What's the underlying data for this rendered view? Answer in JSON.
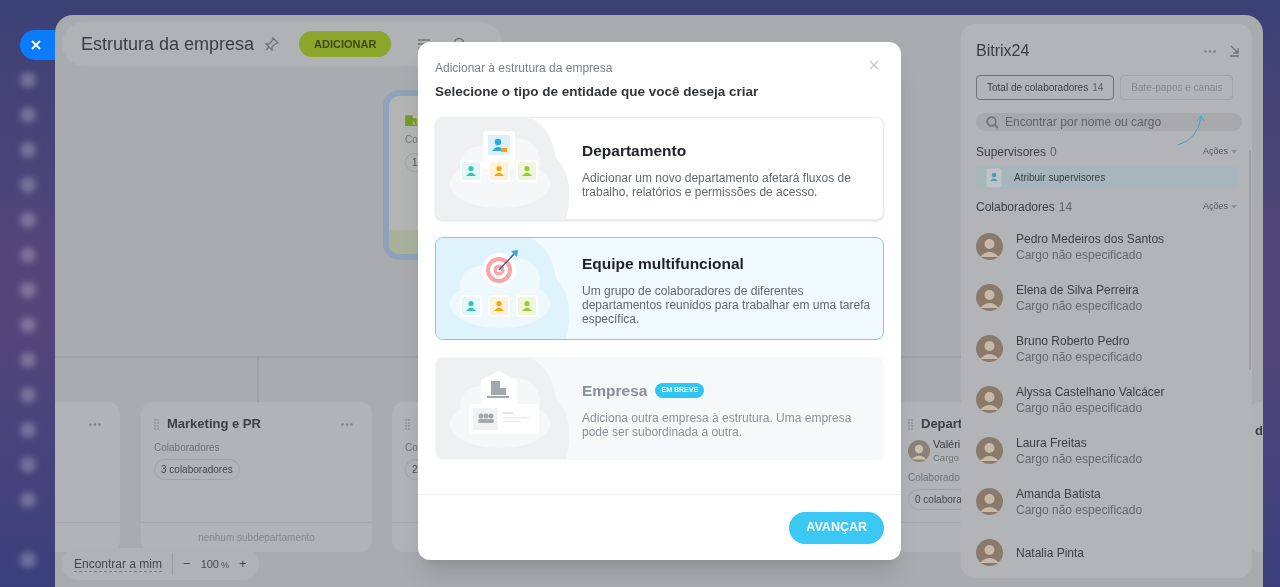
{
  "header": {
    "title": "Estrutura da empresa",
    "add_button": "ADICIONAR"
  },
  "chart": {
    "cards": [
      {
        "kind": "root",
        "label": "Co",
        "chip": "1"
      },
      {
        "kind": "partial"
      },
      {
        "kind": "department",
        "title": "Marketing e PR",
        "label": "Colaboradores",
        "chip": "3 colaboradores",
        "footer": "nenhum subdepartamento"
      },
      {
        "kind": "department",
        "label": "Co",
        "chip": "2"
      },
      {
        "kind": "department",
        "title": "Depart",
        "person_name": "Valéri",
        "person_role": "Cargo",
        "label": "Colaborado",
        "chip": "0 colabora"
      },
      {
        "kind": "edge",
        "title": "d"
      }
    ]
  },
  "bottom_bar": {
    "find_me": "Encontrar a mim",
    "zoom_out": "−",
    "zoom": "100",
    "zoom_unit": "%",
    "zoom_in": "+"
  },
  "dialog": {
    "subtitle": "Adicionar à estrutura da empresa",
    "title": "Selecione o tipo de entidade que você deseja criar",
    "options": [
      {
        "kind": "department",
        "title": "Departamento",
        "description": "Adicionar um novo departamento afetará fluxos de trabalho, relatórios e permissões de acesso.",
        "selected": false,
        "disabled": false
      },
      {
        "kind": "team",
        "title": "Equipe multifuncional",
        "description": "Um grupo de colaboradores de diferentes departamentos reunidos para trabalhar em uma tarefa específica.",
        "selected": true,
        "disabled": false
      },
      {
        "kind": "company",
        "title": "Empresa",
        "badge": "EM BREVE",
        "description": "Adiciona outra empresa à estrutura. Uma empresa pode ser subordinada a outra.",
        "selected": false,
        "disabled": true
      }
    ],
    "next_button": "AVANÇAR"
  },
  "side_panel": {
    "title": "Bitrix24",
    "tabs": [
      {
        "label": "Total de colaboradores",
        "count": "14",
        "selected": true
      },
      {
        "label": "Bate-papos e canais",
        "selected": false
      }
    ],
    "search": {
      "placeholder": "Encontrar por nome ou cargo"
    },
    "supervisors": {
      "heading": "Supervisores",
      "count": "0",
      "actions": "Ações",
      "assign": "Atribuir supervisores"
    },
    "employees": {
      "heading": "Colaboradores",
      "count": "14",
      "actions": "Ações",
      "items": [
        {
          "name": "Pedro Medeiros dos Santos",
          "role": "Cargo não especificado"
        },
        {
          "name": "Elena de Silva Perreira",
          "role": "Cargo não especificado"
        },
        {
          "name": "Bruno Roberto Pedro",
          "role": "Cargo não especificado"
        },
        {
          "name": "Alyssa Castelhano Valcácer",
          "role": "Cargo não especificado"
        },
        {
          "name": "Laura Freitas",
          "role": "Cargo não especificado"
        },
        {
          "name": "Amanda Batista",
          "role": "Cargo não especificado"
        },
        {
          "name": "Natalia Pinta"
        }
      ]
    }
  }
}
